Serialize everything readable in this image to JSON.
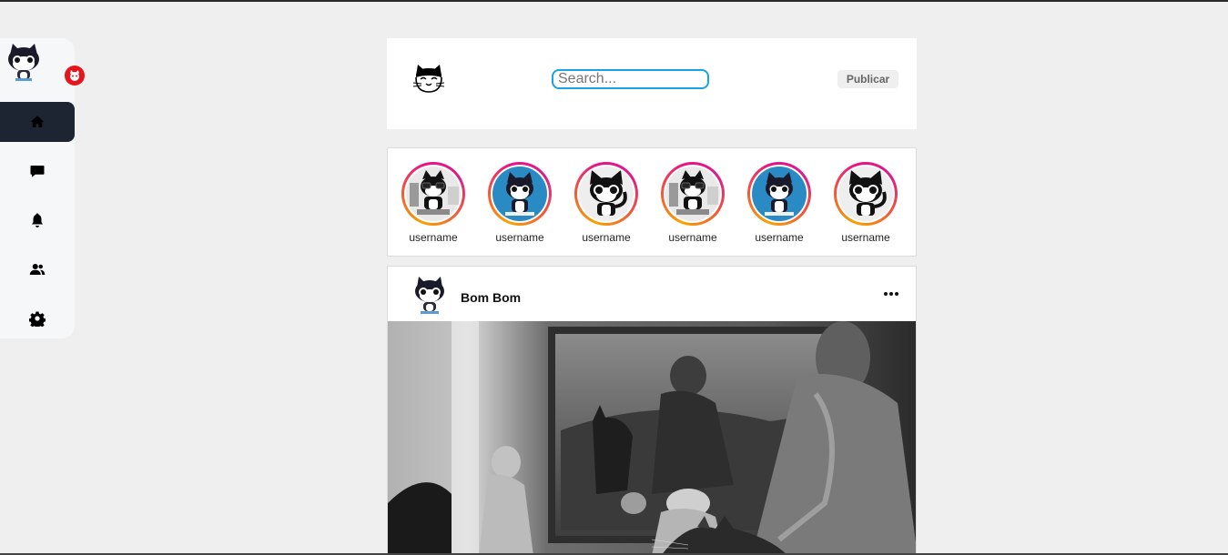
{
  "sidebar": {
    "items": [
      {
        "name": "home",
        "icon": "home-icon",
        "active": true
      },
      {
        "name": "messages",
        "icon": "chat-icon",
        "active": false
      },
      {
        "name": "notifications",
        "icon": "bell-icon",
        "active": false
      },
      {
        "name": "friends",
        "icon": "users-icon",
        "active": false
      },
      {
        "name": "settings",
        "icon": "gear-icon",
        "active": false
      }
    ]
  },
  "header": {
    "search_placeholder": "Search...",
    "publish_label": "Publicar"
  },
  "stories": [
    {
      "username": "username",
      "avatar": "cat-computer"
    },
    {
      "username": "username",
      "avatar": "cat-blue"
    },
    {
      "username": "username",
      "avatar": "cat-bw"
    },
    {
      "username": "username",
      "avatar": "cat-computer"
    },
    {
      "username": "username",
      "avatar": "cat-blue"
    },
    {
      "username": "username",
      "avatar": "cat-bw"
    }
  ],
  "post": {
    "author": "Bom Bom",
    "image": "black-and-white museum scene with cat"
  },
  "colors": {
    "accent": "#1aa1e6",
    "sidebar_active": "#1d2432",
    "badge": "#e8141c",
    "background": "#efefef"
  }
}
